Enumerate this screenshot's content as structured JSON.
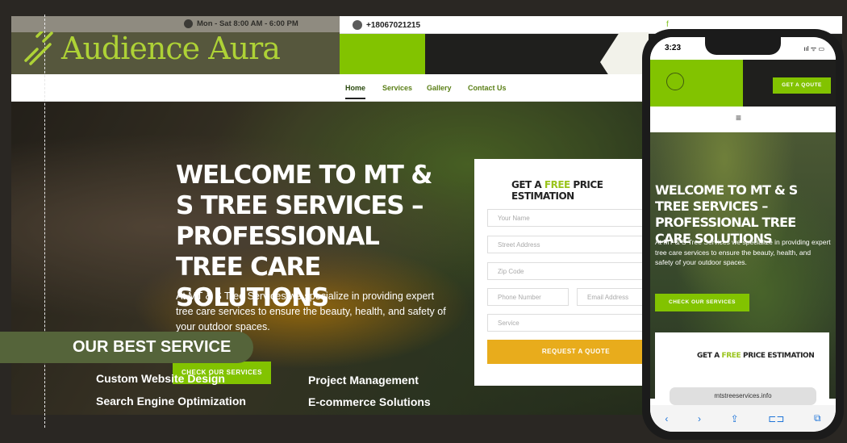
{
  "brand": {
    "name": "Audience Aura"
  },
  "topbar": {
    "hours": "Mon - Sat 8:00 AM - 6:00 PM",
    "phone": "+18067021215",
    "social_icon": "f"
  },
  "nav": {
    "items": [
      "Home",
      "Services",
      "Gallery",
      "Contact Us"
    ]
  },
  "hero": {
    "title": "WELCOME TO MT & S TREE SERVICES – PROFESSIONAL TREE CARE SOLUTIONS",
    "description": "At MT & S Tree Services we specialize in providing expert tree care services to ensure the beauty, health, and safety of your outdoor spaces.",
    "cta": "CHECK OUR SERVICES"
  },
  "quote_form": {
    "title_pre": "GET A ",
    "title_free": "FREE",
    "title_post": " PRICE ESTIMATION",
    "fields": {
      "name": "Your Name",
      "street": "Street Address",
      "zip": "Zip Code",
      "phone": "Phone Number",
      "email": "Email Address",
      "service": "Service"
    },
    "submit": "REQUEST A QUOTE"
  },
  "overlay": {
    "heading": "OUR BEST SERVICE",
    "services": [
      "Custom Website Design",
      "Search Engine Optimization",
      "Project Management",
      "E-commerce Solutions"
    ]
  },
  "mobile": {
    "time": "3:23",
    "signal": "ııl ᯤ ▭",
    "get_quote": "GET A QOUTE",
    "menu_icon": "≡",
    "url": "mtstreeservices.info",
    "tabs": [
      "‹",
      "›",
      "⇪",
      "⊏⊐",
      "⧉"
    ]
  },
  "colors": {
    "accent": "#82c300",
    "olive": "#55643a",
    "gold": "#e8ac1c",
    "dark": "#1f1f1d"
  }
}
